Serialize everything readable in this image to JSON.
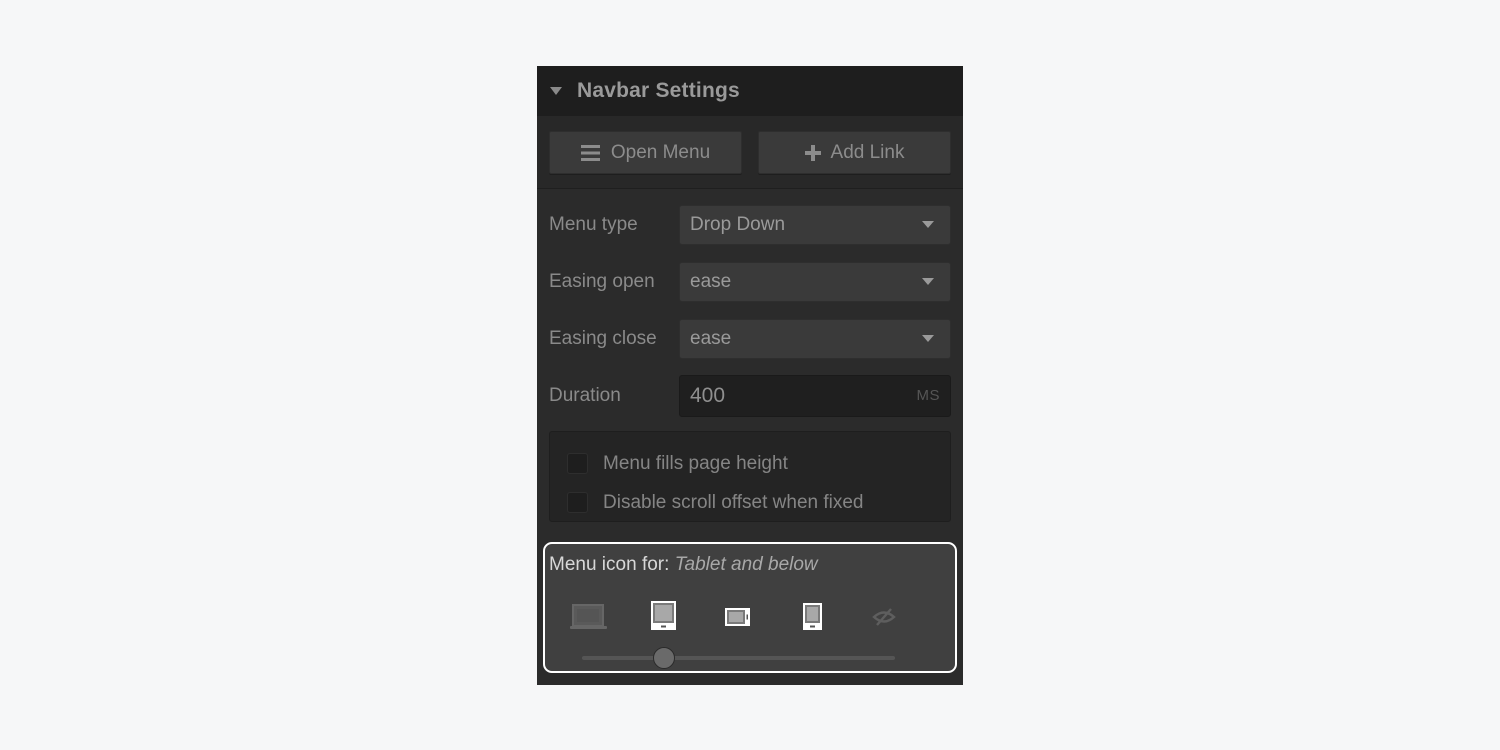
{
  "panel": {
    "title": "Navbar Settings",
    "collapse_icon": "caret-down-icon"
  },
  "actions": {
    "open_menu": {
      "label": "Open Menu",
      "icon": "hamburger-icon"
    },
    "add_link": {
      "label": "Add Link",
      "icon": "plus-icon"
    }
  },
  "fields": {
    "menu_type": {
      "label": "Menu type",
      "value": "Drop Down"
    },
    "easing_open": {
      "label": "Easing open",
      "value": "ease"
    },
    "easing_close": {
      "label": "Easing close",
      "value": "ease"
    },
    "duration": {
      "label": "Duration",
      "value": "400",
      "unit": "MS"
    }
  },
  "checkboxes": [
    {
      "label": "Menu fills page height",
      "checked": false
    },
    {
      "label": "Disable scroll offset when fixed",
      "checked": false
    }
  ],
  "menu_icon": {
    "label": "Menu icon for:",
    "value": "Tablet and below",
    "devices": [
      {
        "name": "desktop",
        "icon": "laptop-icon",
        "active": false
      },
      {
        "name": "tablet",
        "icon": "tablet-icon",
        "active": true
      },
      {
        "name": "mobile-landscape",
        "icon": "phone-landscape-icon",
        "active": true
      },
      {
        "name": "mobile-portrait",
        "icon": "phone-portrait-icon",
        "active": true
      },
      {
        "name": "none",
        "icon": "eye-off-icon",
        "active": false
      }
    ],
    "slider_position_index": 1,
    "slider_stops": 5
  },
  "colors": {
    "accent_outline": "#ffffff",
    "panel_bg": "#2b2b2b",
    "header_bg": "#1e1e1e"
  }
}
